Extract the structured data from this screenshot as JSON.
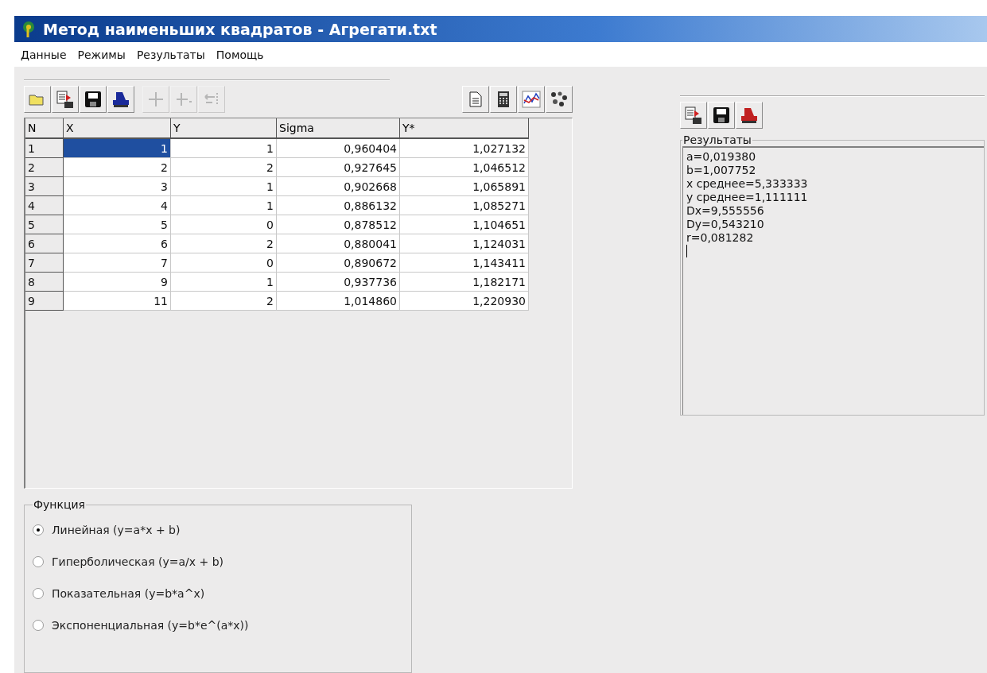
{
  "window": {
    "title": "Метод наименьших квадратов - Агрегати.txt"
  },
  "menu": [
    "Данные",
    "Режимы",
    "Результаты",
    "Помощь"
  ],
  "data_toolbar": [
    {
      "kind": "open",
      "disabled": false
    },
    {
      "kind": "import",
      "disabled": false
    },
    {
      "kind": "save",
      "disabled": false
    },
    {
      "kind": "print",
      "disabled": false
    },
    {
      "kind": "add",
      "disabled": true
    },
    {
      "kind": "insert",
      "disabled": true
    },
    {
      "kind": "delete",
      "disabled": true
    }
  ],
  "tools_toolbar": [
    {
      "kind": "document",
      "disabled": false
    },
    {
      "kind": "calculator",
      "disabled": false
    },
    {
      "kind": "chart",
      "disabled": false
    },
    {
      "kind": "cluster",
      "disabled": false
    }
  ],
  "table": {
    "columns": [
      "N",
      "X",
      "Y",
      "Sigma",
      "Y*"
    ],
    "rows": [
      {
        "cells": [
          {
            "text": "1",
            "selected": false
          },
          {
            "text": "1",
            "selected": true
          },
          {
            "text": "1",
            "selected": false
          },
          {
            "text": "0,960404",
            "selected": false
          },
          {
            "text": "1,027132",
            "selected": false
          }
        ]
      },
      {
        "cells": [
          {
            "text": "2",
            "selected": false
          },
          {
            "text": "2",
            "selected": false
          },
          {
            "text": "2",
            "selected": false
          },
          {
            "text": "0,927645",
            "selected": false
          },
          {
            "text": "1,046512",
            "selected": false
          }
        ]
      },
      {
        "cells": [
          {
            "text": "3",
            "selected": false
          },
          {
            "text": "3",
            "selected": false
          },
          {
            "text": "1",
            "selected": false
          },
          {
            "text": "0,902668",
            "selected": false
          },
          {
            "text": "1,065891",
            "selected": false
          }
        ]
      },
      {
        "cells": [
          {
            "text": "4",
            "selected": false
          },
          {
            "text": "4",
            "selected": false
          },
          {
            "text": "1",
            "selected": false
          },
          {
            "text": "0,886132",
            "selected": false
          },
          {
            "text": "1,085271",
            "selected": false
          }
        ]
      },
      {
        "cells": [
          {
            "text": "5",
            "selected": false
          },
          {
            "text": "5",
            "selected": false
          },
          {
            "text": "0",
            "selected": false
          },
          {
            "text": "0,878512",
            "selected": false
          },
          {
            "text": "1,104651",
            "selected": false
          }
        ]
      },
      {
        "cells": [
          {
            "text": "6",
            "selected": false
          },
          {
            "text": "6",
            "selected": false
          },
          {
            "text": "2",
            "selected": false
          },
          {
            "text": "0,880041",
            "selected": false
          },
          {
            "text": "1,124031",
            "selected": false
          }
        ]
      },
      {
        "cells": [
          {
            "text": "7",
            "selected": false
          },
          {
            "text": "7",
            "selected": false
          },
          {
            "text": "0",
            "selected": false
          },
          {
            "text": "0,890672",
            "selected": false
          },
          {
            "text": "1,143411",
            "selected": false
          }
        ]
      },
      {
        "cells": [
          {
            "text": "8",
            "selected": false
          },
          {
            "text": "9",
            "selected": false
          },
          {
            "text": "1",
            "selected": false
          },
          {
            "text": "0,937736",
            "selected": false
          },
          {
            "text": "1,182171",
            "selected": false
          }
        ]
      },
      {
        "cells": [
          {
            "text": "9",
            "selected": false
          },
          {
            "text": "11",
            "selected": false
          },
          {
            "text": "2",
            "selected": false
          },
          {
            "text": "1,014860",
            "selected": false
          },
          {
            "text": "1,220930",
            "selected": false
          }
        ]
      }
    ]
  },
  "function_group": {
    "title": "Функция",
    "options": [
      {
        "label": "Линейная (y=a*x + b)",
        "selected": true
      },
      {
        "label": "Гиперболическая (y=a/x + b)",
        "selected": false
      },
      {
        "label": "Показательная (y=b*a^x)",
        "selected": false
      },
      {
        "label": "Экспоненциальная (y=b*e^(a*x))",
        "selected": false
      }
    ]
  },
  "results_toolbar": [
    {
      "kind": "import",
      "disabled": false
    },
    {
      "kind": "save",
      "disabled": false
    },
    {
      "kind": "print_red",
      "disabled": false
    }
  ],
  "results": {
    "title": "Результаты",
    "lines": [
      "a=0,019380",
      "b=1,007752",
      "x среднее=5,333333",
      "y среднее=1,111111",
      "Dx=9,555556",
      "Dy=0,543210",
      "r=0,081282"
    ]
  }
}
